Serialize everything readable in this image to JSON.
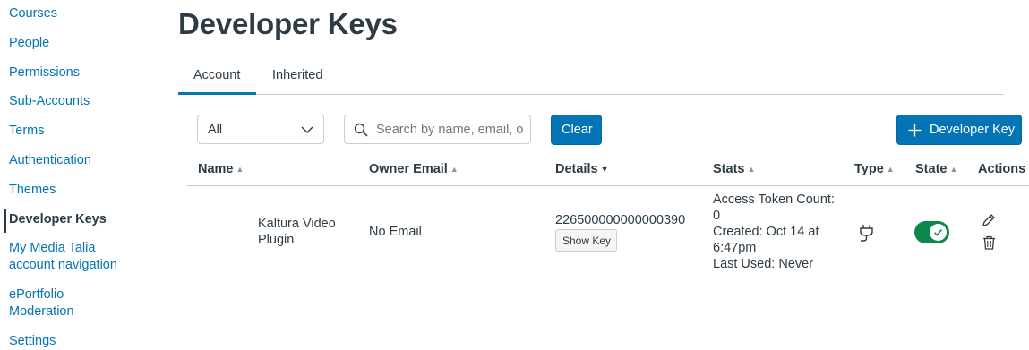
{
  "sidebar": {
    "items": [
      {
        "label": "Courses"
      },
      {
        "label": "People"
      },
      {
        "label": "Permissions"
      },
      {
        "label": "Sub-Accounts"
      },
      {
        "label": "Terms"
      },
      {
        "label": "Authentication"
      },
      {
        "label": "Themes"
      },
      {
        "label": "Developer Keys",
        "active": true
      },
      {
        "label_line1": "My Media Talia",
        "label_line2": "account navigation"
      },
      {
        "label_line1": "ePortfolio",
        "label_line2": "Moderation"
      },
      {
        "label": "Settings"
      }
    ]
  },
  "page": {
    "title": "Developer Keys",
    "tabs": [
      {
        "label": "Account",
        "selected": true
      },
      {
        "label": "Inherited",
        "selected": false
      }
    ]
  },
  "filters": {
    "type_select_value": "All",
    "search_placeholder": "Search by name, email, or ID",
    "search_value": "",
    "clear_label": "Clear",
    "add_label": "Developer Key"
  },
  "table": {
    "headers": {
      "name": "Name",
      "owner_email": "Owner Email",
      "details": "Details",
      "stats": "Stats",
      "type": "Type",
      "state": "State",
      "actions": "Actions"
    },
    "rows": [
      {
        "name_line1": "Kaltura Video",
        "name_line2": "Plugin",
        "owner_email": "No Email",
        "key_id": "226500000000000390",
        "show_key_label": "Show Key",
        "stats_line1": "Access Token Count:",
        "stats_line2": "0",
        "stats_line3": "Created: Oct 14 at",
        "stats_line4": "6:47pm",
        "stats_line5": "Last Used: Never",
        "type_icon": "plug-icon",
        "state": "on"
      }
    ]
  },
  "colors": {
    "link": "#0374b5",
    "primary": "#0374b5",
    "toggle_on": "#0b874b",
    "text": "#2d3b45",
    "border": "#c7cdd1"
  }
}
